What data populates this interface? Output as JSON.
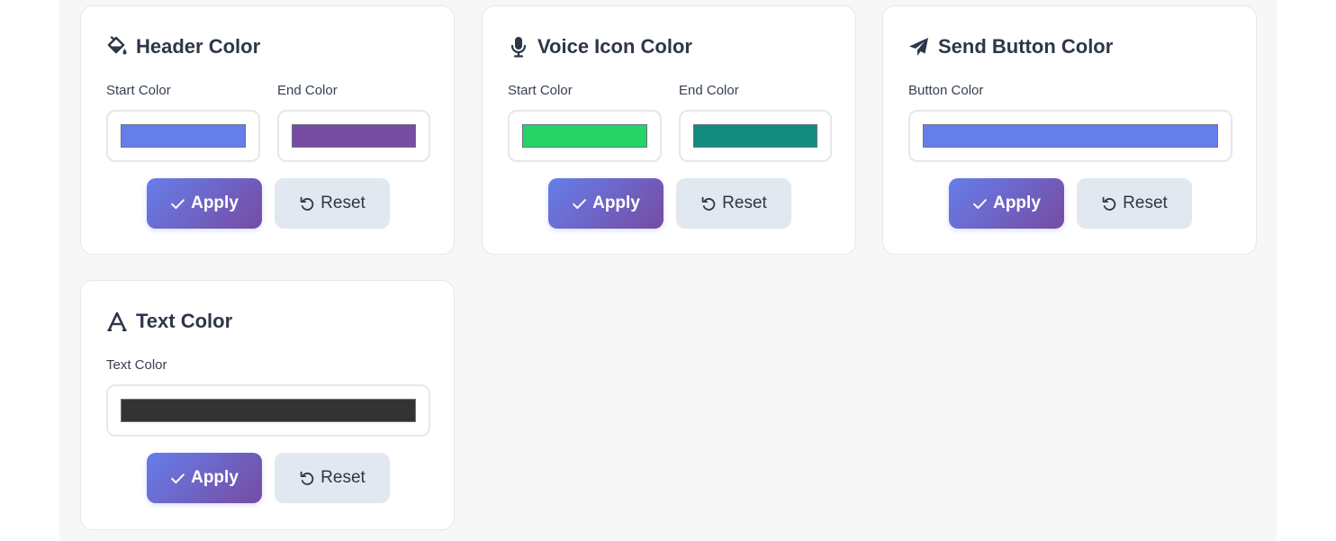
{
  "cards": [
    {
      "title": "Header Color",
      "icon": "paint-bucket-icon",
      "fields": [
        {
          "label": "Start Color",
          "value": "#667eea"
        },
        {
          "label": "End Color",
          "value": "#764ba2"
        }
      ],
      "apply_label": "Apply",
      "reset_label": "Reset"
    },
    {
      "title": "Voice Icon Color",
      "icon": "microphone-icon",
      "fields": [
        {
          "label": "Start Color",
          "value": "#25d366"
        },
        {
          "label": "End Color",
          "value": "#128c7e"
        }
      ],
      "apply_label": "Apply",
      "reset_label": "Reset"
    },
    {
      "title": "Send Button Color",
      "icon": "paper-plane-icon",
      "fields": [
        {
          "label": "Button Color",
          "value": "#667eea"
        }
      ],
      "apply_label": "Apply",
      "reset_label": "Reset"
    },
    {
      "title": "Text Color",
      "icon": "font-icon",
      "fields": [
        {
          "label": "Text Color",
          "value": "#333333"
        }
      ],
      "apply_label": "Apply",
      "reset_label": "Reset"
    }
  ],
  "colors": {
    "apply_gradient_start": "#667eea",
    "apply_gradient_end": "#764ba2",
    "reset_background": "#e2e8f0"
  }
}
